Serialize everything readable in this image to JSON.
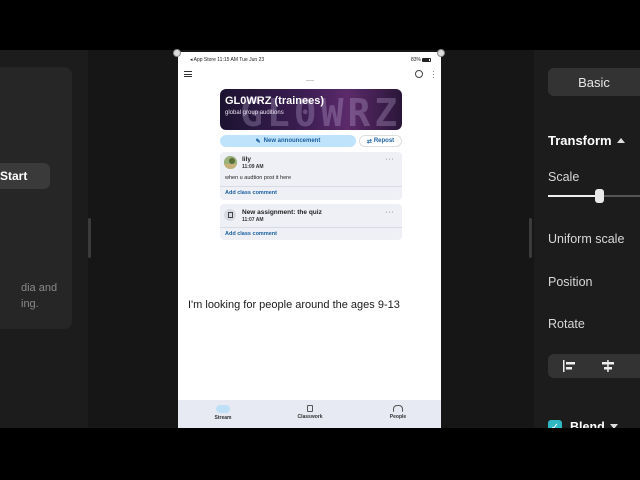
{
  "left_panel": {
    "button_label": "Start",
    "hint_text_line1": "dia and",
    "hint_text_line2": "ing."
  },
  "right_panel": {
    "basic_label": "Basic",
    "transform_label": "Transform",
    "scale_label": "Scale",
    "scale_value": 0.55,
    "uniform_scale_label": "Uniform scale",
    "position_label": "Position",
    "rotate_label": "Rotate",
    "blend_label": "Blend",
    "blend_checked": true,
    "accent_color": "#2fb8c4"
  },
  "phone": {
    "status_left": "◂ App Store  11:15 AM  Tue Jun 23",
    "status_right": "83%",
    "class_title": "GL0WRZ (trainees)",
    "class_subtitle": "global group auditions",
    "banner_art_text": "GL0WRZ",
    "new_announcement": "New announcement",
    "repost": "Repost",
    "posts": [
      {
        "author": "lily",
        "time": "11:09 AM",
        "body": "when u audtion post it here",
        "comment": "Add class comment"
      },
      {
        "author": "New assignment: the quiz",
        "time": "11:07 AM",
        "comment": "Add class comment"
      }
    ],
    "caption": "I'm looking for people around the ages 9-13",
    "nav": {
      "stream": "Stream",
      "classwork": "Classwork",
      "people": "People"
    }
  }
}
